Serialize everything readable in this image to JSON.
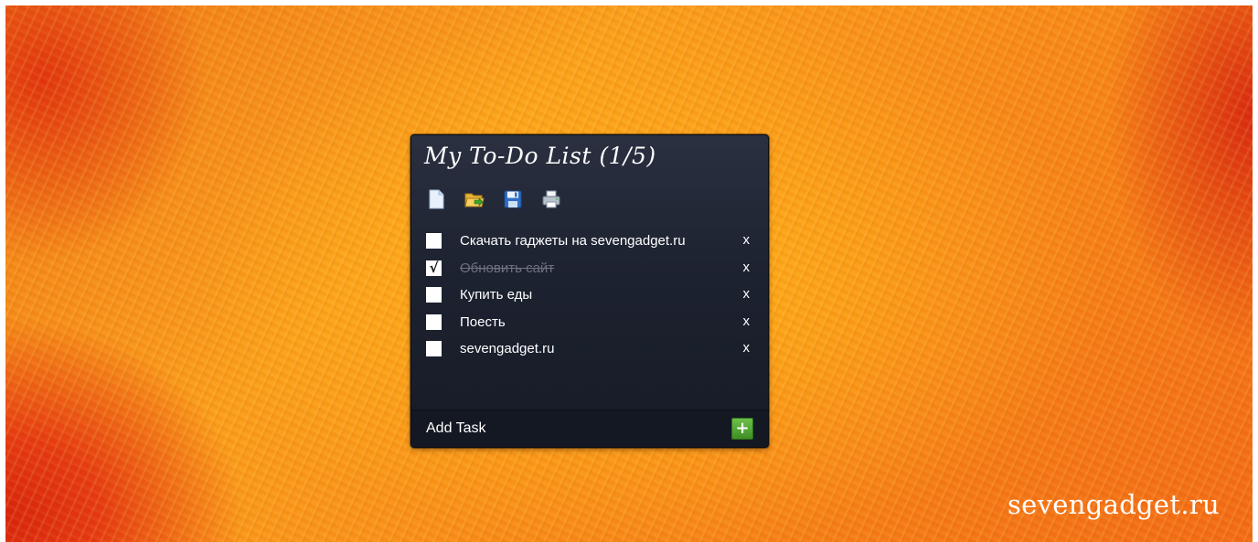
{
  "gadget": {
    "title": "My To-Do List (1/5)",
    "toolbar": [
      {
        "name": "new-document-icon"
      },
      {
        "name": "open-folder-icon"
      },
      {
        "name": "save-icon"
      },
      {
        "name": "print-icon"
      }
    ],
    "tasks": [
      {
        "label": "Скачать гаджеты на sevengadget.ru",
        "checked": false,
        "check_glyph": "",
        "delete_label": "x"
      },
      {
        "label": "Обновить сайт",
        "checked": true,
        "check_glyph": "√",
        "delete_label": "x"
      },
      {
        "label": "Купить еды",
        "checked": false,
        "check_glyph": "",
        "delete_label": "x"
      },
      {
        "label": "Поесть",
        "checked": false,
        "check_glyph": "",
        "delete_label": "x"
      },
      {
        "label": "sevengadget.ru",
        "checked": false,
        "check_glyph": "",
        "delete_label": "x"
      }
    ],
    "footer": {
      "add_task_label": "Add Task",
      "add_button_glyph": "+"
    }
  },
  "desktop": {
    "watermark": "sevengadget.ru"
  },
  "colors": {
    "panel": "#1d2230",
    "add_button": "#4fa32f",
    "done_text": "#6d7280"
  }
}
